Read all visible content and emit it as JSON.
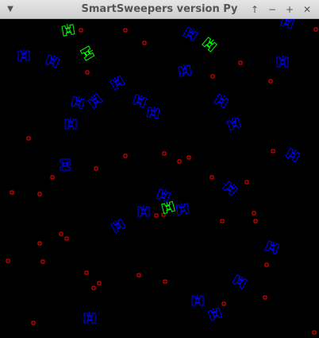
{
  "window": {
    "title": "SmartSweepers version Py",
    "menu_icon": "chevron-down-icon",
    "buttons": [
      "arrow-up-icon",
      "minimize-icon",
      "maximize-icon",
      "close-icon"
    ]
  },
  "game": {
    "background": "#000000",
    "mine_color": "#ff0000",
    "sweeper_color": "#0000ff",
    "best_sweeper_color": "#00ff00"
  }
}
